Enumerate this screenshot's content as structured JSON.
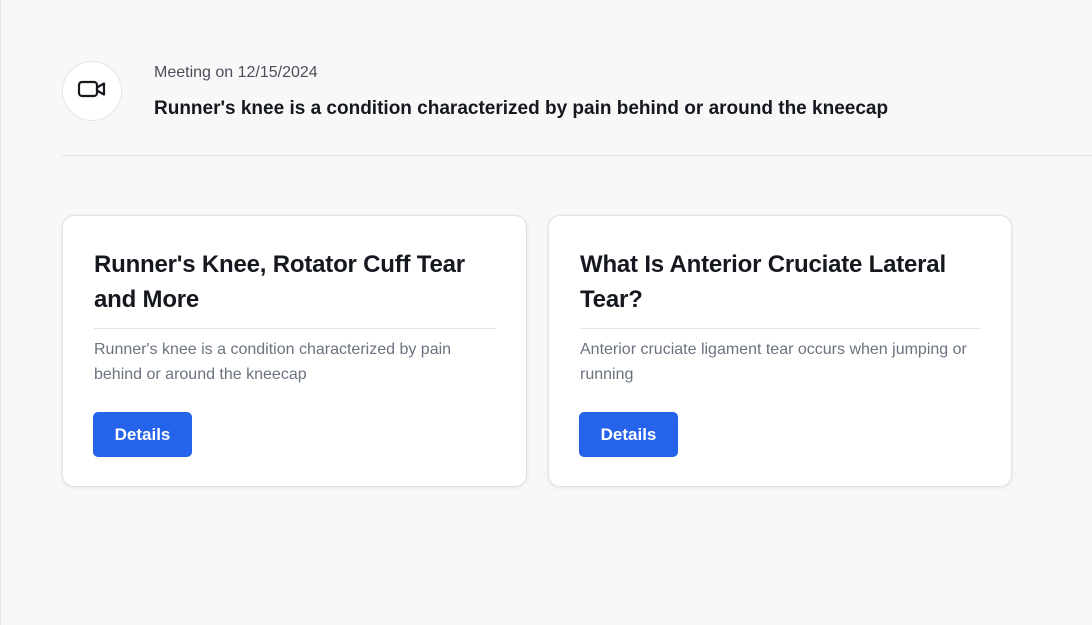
{
  "meeting": {
    "icon": "video-camera-icon",
    "date_label": "Meeting on 12/15/2024",
    "summary": "Runner's knee is a condition characterized by pain behind or around the kneecap"
  },
  "cards": [
    {
      "title": "Runner's Knee, Rotator Cuff Tear and More",
      "description": "Runner's knee is a condition characterized by pain behind or around the kneecap",
      "button_label": "Details"
    },
    {
      "title": "What Is Anterior Cruciate Lateral Tear?",
      "description": "Anterior cruciate ligament tear occurs when jumping or running",
      "button_label": "Details"
    }
  ],
  "colors": {
    "accent": "#2563eb",
    "background": "#f8f8f8",
    "card": "#ffffff",
    "muted_text": "#6b7280"
  }
}
